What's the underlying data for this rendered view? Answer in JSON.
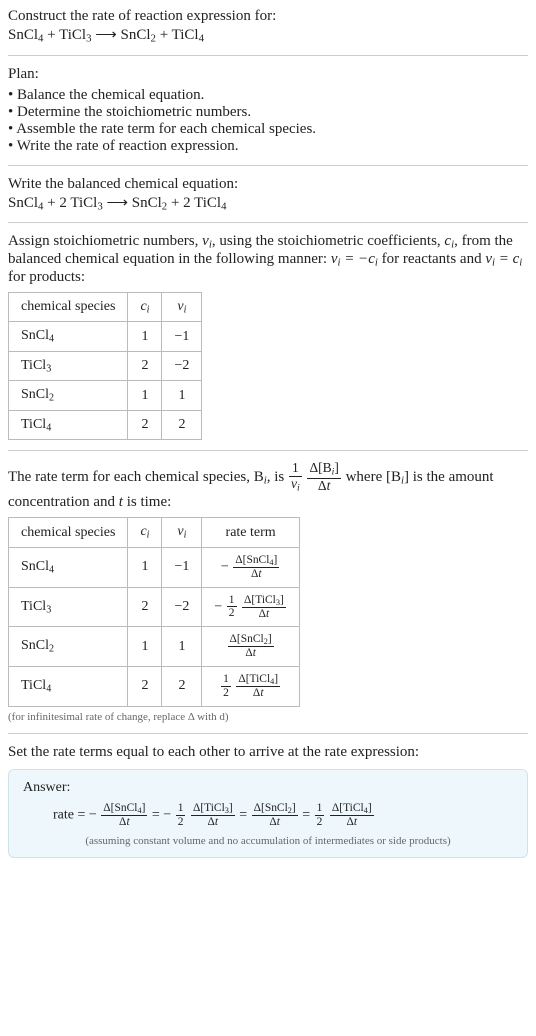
{
  "intro": {
    "title": "Construct the rate of reaction expression for:",
    "equation": "SnCl₄ + TiCl₃ ⟶ SnCl₂ + TiCl₄"
  },
  "plan": {
    "heading": "Plan:",
    "items": [
      "Balance the chemical equation.",
      "Determine the stoichiometric numbers.",
      "Assemble the rate term for each chemical species.",
      "Write the rate of reaction expression."
    ]
  },
  "balanced": {
    "heading": "Write the balanced chemical equation:",
    "equation": "SnCl₄ + 2 TiCl₃ ⟶ SnCl₂ + 2 TiCl₄"
  },
  "stoich": {
    "heading_p1": "Assign stoichiometric numbers, ",
    "heading_sym1": "νᵢ",
    "heading_p2": ", using the stoichiometric coefficients, ",
    "heading_sym2": "cᵢ",
    "heading_p3": ", from the balanced chemical equation in the following manner: ",
    "rel_reactants": "νᵢ = −cᵢ",
    "rel_mid": " for reactants and ",
    "rel_products": "νᵢ = cᵢ",
    "rel_end": " for products:",
    "cols": [
      "chemical species",
      "cᵢ",
      "νᵢ"
    ],
    "rows": [
      {
        "species": "SnCl₄",
        "c": "1",
        "nu": "−1"
      },
      {
        "species": "TiCl₃",
        "c": "2",
        "nu": "−2"
      },
      {
        "species": "SnCl₂",
        "c": "1",
        "nu": "1"
      },
      {
        "species": "TiCl₄",
        "c": "2",
        "nu": "2"
      }
    ]
  },
  "rate_term": {
    "p1": "The rate term for each chemical species, ",
    "sym_Bi": "Bᵢ",
    "p2": ", is ",
    "coef_num": "1",
    "coef_den": "νᵢ",
    "dfrac_num": "Δ[Bᵢ]",
    "dfrac_den": "Δt",
    "p3": " where ",
    "br1": "[Bᵢ]",
    "p4": " is the amount concentration and ",
    "sym_t": "t",
    "p5": " is time:",
    "cols": [
      "chemical species",
      "cᵢ",
      "νᵢ",
      "rate term"
    ],
    "rows": [
      {
        "species": "SnCl₄",
        "c": "1",
        "nu": "−1",
        "coef_num": "",
        "coef_den": "",
        "sign": "−",
        "num": "Δ[SnCl₄]",
        "den": "Δt"
      },
      {
        "species": "TiCl₃",
        "c": "2",
        "nu": "−2",
        "coef_num": "1",
        "coef_den": "2",
        "sign": "−",
        "num": "Δ[TiCl₃]",
        "den": "Δt"
      },
      {
        "species": "SnCl₂",
        "c": "1",
        "nu": "1",
        "coef_num": "",
        "coef_den": "",
        "sign": "",
        "num": "Δ[SnCl₂]",
        "den": "Δt"
      },
      {
        "species": "TiCl₄",
        "c": "2",
        "nu": "2",
        "coef_num": "1",
        "coef_den": "2",
        "sign": "",
        "num": "Δ[TiCl₄]",
        "den": "Δt"
      }
    ],
    "note": "(for infinitesimal rate of change, replace Δ with d)"
  },
  "final": {
    "heading": "Set the rate terms equal to each other to arrive at the rate expression:"
  },
  "answer": {
    "label": "Answer:",
    "lead": "rate = ",
    "t1": {
      "sign": "−",
      "coef_num": "",
      "coef_den": "",
      "num": "Δ[SnCl₄]",
      "den": "Δt"
    },
    "eq1": " = ",
    "t2": {
      "sign": "−",
      "coef_num": "1",
      "coef_den": "2",
      "num": "Δ[TiCl₃]",
      "den": "Δt"
    },
    "eq2": " = ",
    "t3": {
      "sign": "",
      "coef_num": "",
      "coef_den": "",
      "num": "Δ[SnCl₂]",
      "den": "Δt"
    },
    "eq3": " = ",
    "t4": {
      "sign": "",
      "coef_num": "1",
      "coef_den": "2",
      "num": "Δ[TiCl₄]",
      "den": "Δt"
    },
    "assume": "(assuming constant volume and no accumulation of intermediates or side products)"
  }
}
